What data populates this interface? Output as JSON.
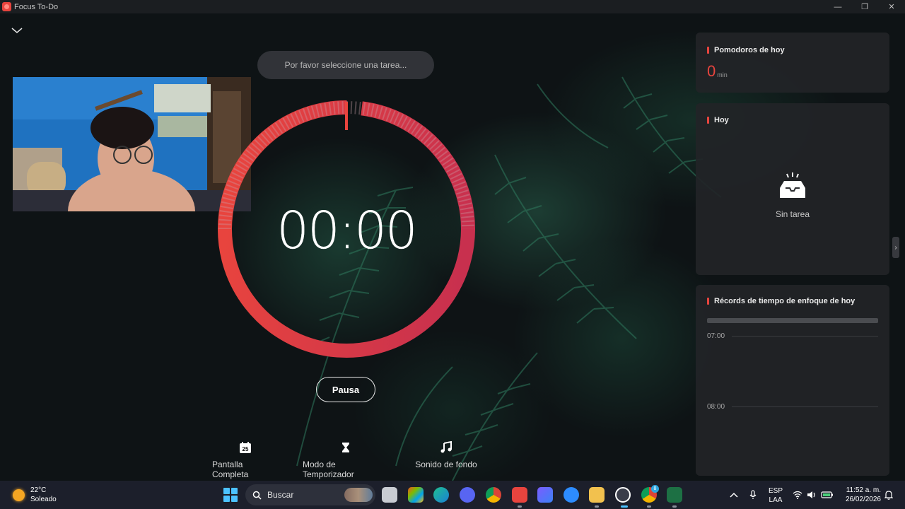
{
  "window": {
    "title": "Focus To-Do",
    "minimize_glyph": "—",
    "maximize_glyph": "❐",
    "close_glyph": "✕"
  },
  "main": {
    "task_placeholder": "Por favor seleccione una tarea...",
    "timer": "00:00",
    "pause_label": "Pausa",
    "progress_fraction": 0.98,
    "tools": [
      {
        "label": "Pantalla Completa",
        "icon": "calendar-icon",
        "badge": "25"
      },
      {
        "label": "Modo de Temporizador",
        "icon": "hourglass-icon"
      },
      {
        "label": "Sonido de fondo",
        "icon": "music-note-icon"
      }
    ]
  },
  "panels": {
    "pomodoros": {
      "title": "Pomodoros de hoy",
      "value": "0",
      "unit": "min"
    },
    "today": {
      "title": "Hoy",
      "empty_label": "Sin tarea"
    },
    "records": {
      "title": "Récords de tiempo de enfoque de hoy",
      "hours": [
        "07:00",
        "08:00"
      ]
    }
  },
  "taskbar": {
    "temperature": "22°C",
    "condition": "Soleado",
    "search_label": "Buscar",
    "language": "ESP",
    "layout": "LAA",
    "time": "11:52 a. m.",
    "date": "26/02/2026",
    "chrome_badge": "8"
  },
  "colors": {
    "accent": "#e8443e",
    "ring": "#d4344c",
    "panel": "#222427",
    "taskbar": "#1c1f2b"
  }
}
